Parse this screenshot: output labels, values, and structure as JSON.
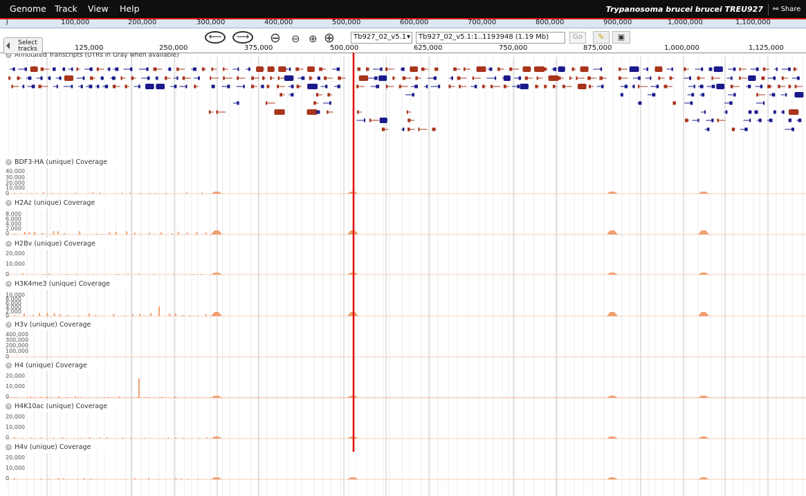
{
  "menu": {
    "items": [
      "Genome",
      "Track",
      "View",
      "Help"
    ],
    "organism": "Trypanosoma brucei brucei TREU927",
    "share": "Share"
  },
  "overview_ticks": [
    ")",
    "100,000",
    "200,000",
    "300,000",
    "400,000",
    "500,000",
    "600,000",
    "700,000",
    "800,000",
    "900,000",
    "1,000,000",
    "1,100,000"
  ],
  "navigation": {
    "ref_seq": "Tb927_02_v5.1",
    "location": "Tb927_02_v5.1:1..1193948 (1.19 Mb)",
    "go_label": "Go"
  },
  "select_tracks": {
    "line1": "Select",
    "line2": "tracks"
  },
  "ruler_ticks": [
    "125,000",
    "250,000",
    "375,000",
    "500,000",
    "625,000",
    "750,000",
    "875,000",
    "1,000,000",
    "1,125,000"
  ],
  "annotation_track": {
    "label": "Annotated Transcripts (UTRs in Gray when available)"
  },
  "coverage_tracks": [
    {
      "label": "BDF3-HA (unique) Coverage",
      "ticks": [
        "40,000",
        "30,000",
        "20,000",
        "10,000",
        "0"
      ]
    },
    {
      "label": "H2Az (unique) Coverage",
      "ticks": [
        "8,000",
        "6,000",
        "4,000",
        "2,000",
        "0"
      ]
    },
    {
      "label": "H2Bv (unique) Coverage",
      "ticks": [
        "20,000",
        "10,000",
        "0"
      ]
    },
    {
      "label": "H3K4me3 (unique) Coverage",
      "ticks": [
        "10,000",
        "8,000",
        "6,000",
        "4,000",
        "2,000",
        "0"
      ]
    },
    {
      "label": "H3v (unique) Coverage",
      "ticks": [
        "400,000",
        "300,000",
        "200,000",
        "100,000",
        "0"
      ]
    },
    {
      "label": "H4 (unique) Coverage",
      "ticks": [
        "20,000",
        "10,000",
        "0"
      ]
    },
    {
      "label": "H4K10ac (unique) Coverage",
      "ticks": [
        "20,000",
        "10,000",
        "0"
      ]
    },
    {
      "label": "H4v (unique) Coverage",
      "ticks": [
        "20,000",
        "10,000",
        "0"
      ]
    }
  ],
  "colors": {
    "forward_gene": "#1a1a8c",
    "reverse_gene": "#a8341b",
    "coverage": "#f0a070",
    "highlight_line": "#e00000",
    "menubar": "#0f0f0f"
  }
}
